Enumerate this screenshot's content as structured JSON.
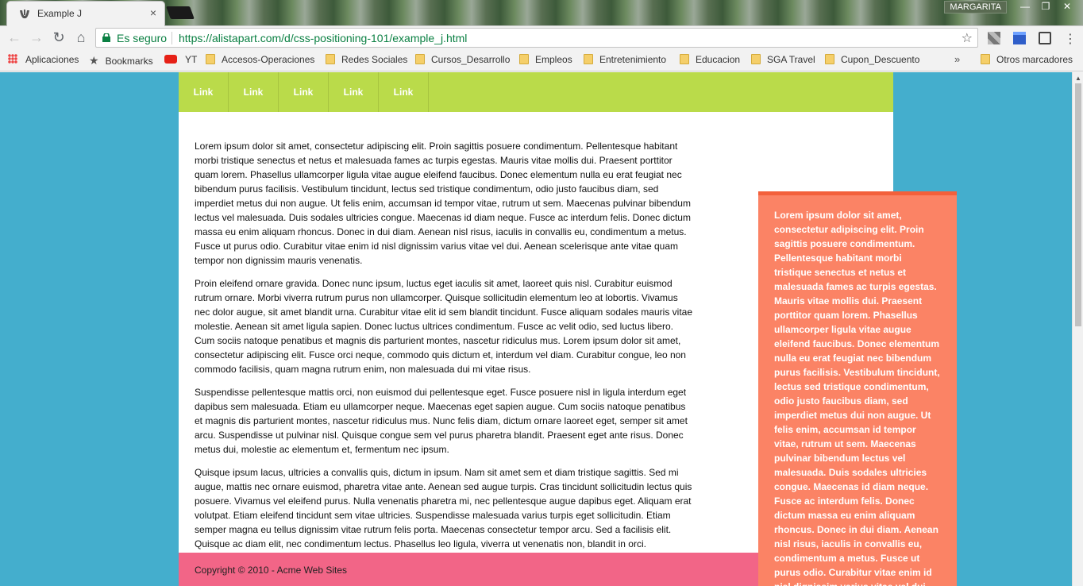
{
  "browser": {
    "tab_title": "Example J",
    "tab_close": "×",
    "profile_name": "MARGARITA",
    "window_controls": {
      "minimize": "—",
      "maximize": "❐",
      "close": "✕"
    },
    "nav": {
      "back": "←",
      "forward": "→",
      "reload": "↻",
      "home": "⌂"
    },
    "security_label": "Es seguro",
    "url": "https://alistapart.com/d/css-positioning-101/example_j.html",
    "star": "☆",
    "menu": "⋮",
    "bookmarks_more": "»",
    "bookmarks": {
      "apps": "Aplicaciones",
      "bookmarks": "Bookmarks",
      "yt": "YT",
      "b1": "Accesos-Operaciones",
      "b2": "Redes Sociales",
      "b3": "Cursos_Desarrollo",
      "b4": "Empleos",
      "b5": "Entretenimiento",
      "b6": "Educacion",
      "b7": "SGA Travel",
      "b8": "Cupon_Descuento",
      "other": "Otros marcadores"
    },
    "icons": [
      "favicon-icon",
      "lock-icon",
      "star-icon",
      "menu-icon",
      "apps-icon",
      "folder-icon",
      "youtube-icon"
    ]
  },
  "page": {
    "colors": {
      "background": "#44aecd",
      "nav": "#badb4a",
      "sidebar": "#fb8365",
      "sidebar_border": "#f3603b",
      "footer": "#f26587"
    },
    "nav_links": [
      "Link",
      "Link",
      "Link",
      "Link",
      "Link"
    ],
    "paragraphs": [
      "Lorem ipsum dolor sit amet, consectetur adipiscing elit. Proin sagittis posuere condimentum. Pellentesque habitant morbi tristique senectus et netus et malesuada fames ac turpis egestas. Mauris vitae mollis dui. Praesent porttitor quam lorem. Phasellus ullamcorper ligula vitae augue eleifend faucibus. Donec elementum nulla eu erat feugiat nec bibendum purus facilisis. Vestibulum tincidunt, lectus sed tristique condimentum, odio justo faucibus diam, sed imperdiet metus dui non augue. Ut felis enim, accumsan id tempor vitae, rutrum ut sem. Maecenas pulvinar bibendum lectus vel malesuada. Duis sodales ultricies congue. Maecenas id diam neque. Fusce ac interdum felis. Donec dictum massa eu enim aliquam rhoncus. Donec in dui diam. Aenean nisl risus, iaculis in convallis eu, condimentum a metus. Fusce ut purus odio. Curabitur vitae enim id nisl dignissim varius vitae vel dui. Aenean scelerisque ante vitae quam tempor non dignissim mauris venenatis.",
      "Proin eleifend ornare gravida. Donec nunc ipsum, luctus eget iaculis sit amet, laoreet quis nisl. Curabitur euismod rutrum ornare. Morbi viverra rutrum purus non ullamcorper. Quisque sollicitudin elementum leo at lobortis. Vivamus nec dolor augue, sit amet blandit urna. Curabitur vitae elit id sem blandit tincidunt. Fusce aliquam sodales mauris vitae molestie. Aenean sit amet ligula sapien. Donec luctus ultrices condimentum. Fusce ac velit odio, sed luctus libero. Cum sociis natoque penatibus et magnis dis parturient montes, nascetur ridiculus mus. Lorem ipsum dolor sit amet, consectetur adipiscing elit. Fusce orci neque, commodo quis dictum et, interdum vel diam. Curabitur congue, leo non commodo facilisis, quam magna rutrum enim, non malesuada dui mi vitae risus.",
      "Suspendisse pellentesque mattis orci, non euismod dui pellentesque eget. Fusce posuere nisl in ligula interdum eget dapibus sem malesuada. Etiam eu ullamcorper neque. Maecenas eget sapien augue. Cum sociis natoque penatibus et magnis dis parturient montes, nascetur ridiculus mus. Nunc felis diam, dictum ornare laoreet eget, semper sit amet arcu. Suspendisse ut pulvinar nisl. Quisque congue sem vel purus pharetra blandit. Praesent eget ante risus. Donec metus dui, molestie ac elementum et, fermentum nec ipsum.",
      "Quisque ipsum lacus, ultricies a convallis quis, dictum in ipsum. Nam sit amet sem et diam tristique sagittis. Sed mi augue, mattis nec ornare euismod, pharetra vitae ante. Aenean sed augue turpis. Cras tincidunt sollicitudin lectus quis posuere. Vivamus vel eleifend purus. Nulla venenatis pharetra mi, nec pellentesque augue dapibus eget. Aliquam erat volutpat. Etiam eleifend tincidunt sem vitae ultricies. Suspendisse malesuada varius turpis eget sollicitudin. Etiam semper magna eu tellus dignissim vitae rutrum felis porta. Maecenas consectetur tempor arcu. Sed a facilisis elit. Quisque ac diam elit, nec condimentum lectus. Phasellus leo ligula, viverra ut venenatis non, blandit in orci."
    ],
    "sidebar_text": "Lorem ipsum dolor sit amet, consectetur adipiscing elit. Proin sagittis posuere condimentum. Pellentesque habitant morbi tristique senectus et netus et malesuada fames ac turpis egestas. Mauris vitae mollis dui. Praesent porttitor quam lorem. Phasellus ullamcorper ligula vitae augue eleifend faucibus. Donec elementum nulla eu erat feugiat nec bibendum purus facilisis. Vestibulum tincidunt, lectus sed tristique condimentum, odio justo faucibus diam, sed imperdiet metus dui non augue. Ut felis enim, accumsan id tempor vitae, rutrum ut sem. Maecenas pulvinar bibendum lectus vel malesuada. Duis sodales ultricies congue. Maecenas id diam neque. Fusce ac interdum felis. Donec dictum massa eu enim aliquam rhoncus. Donec in dui diam. Aenean nisl risus, iaculis in convallis eu, condimentum a metus. Fusce ut purus odio. Curabitur vitae enim id nisl dignissim varius vitae vel dui. Aenean scelerisque ante vitae quam tempor non dignissim mauris venenatis.",
    "footer": "Copyright © 2010 - Acme Web Sites"
  }
}
